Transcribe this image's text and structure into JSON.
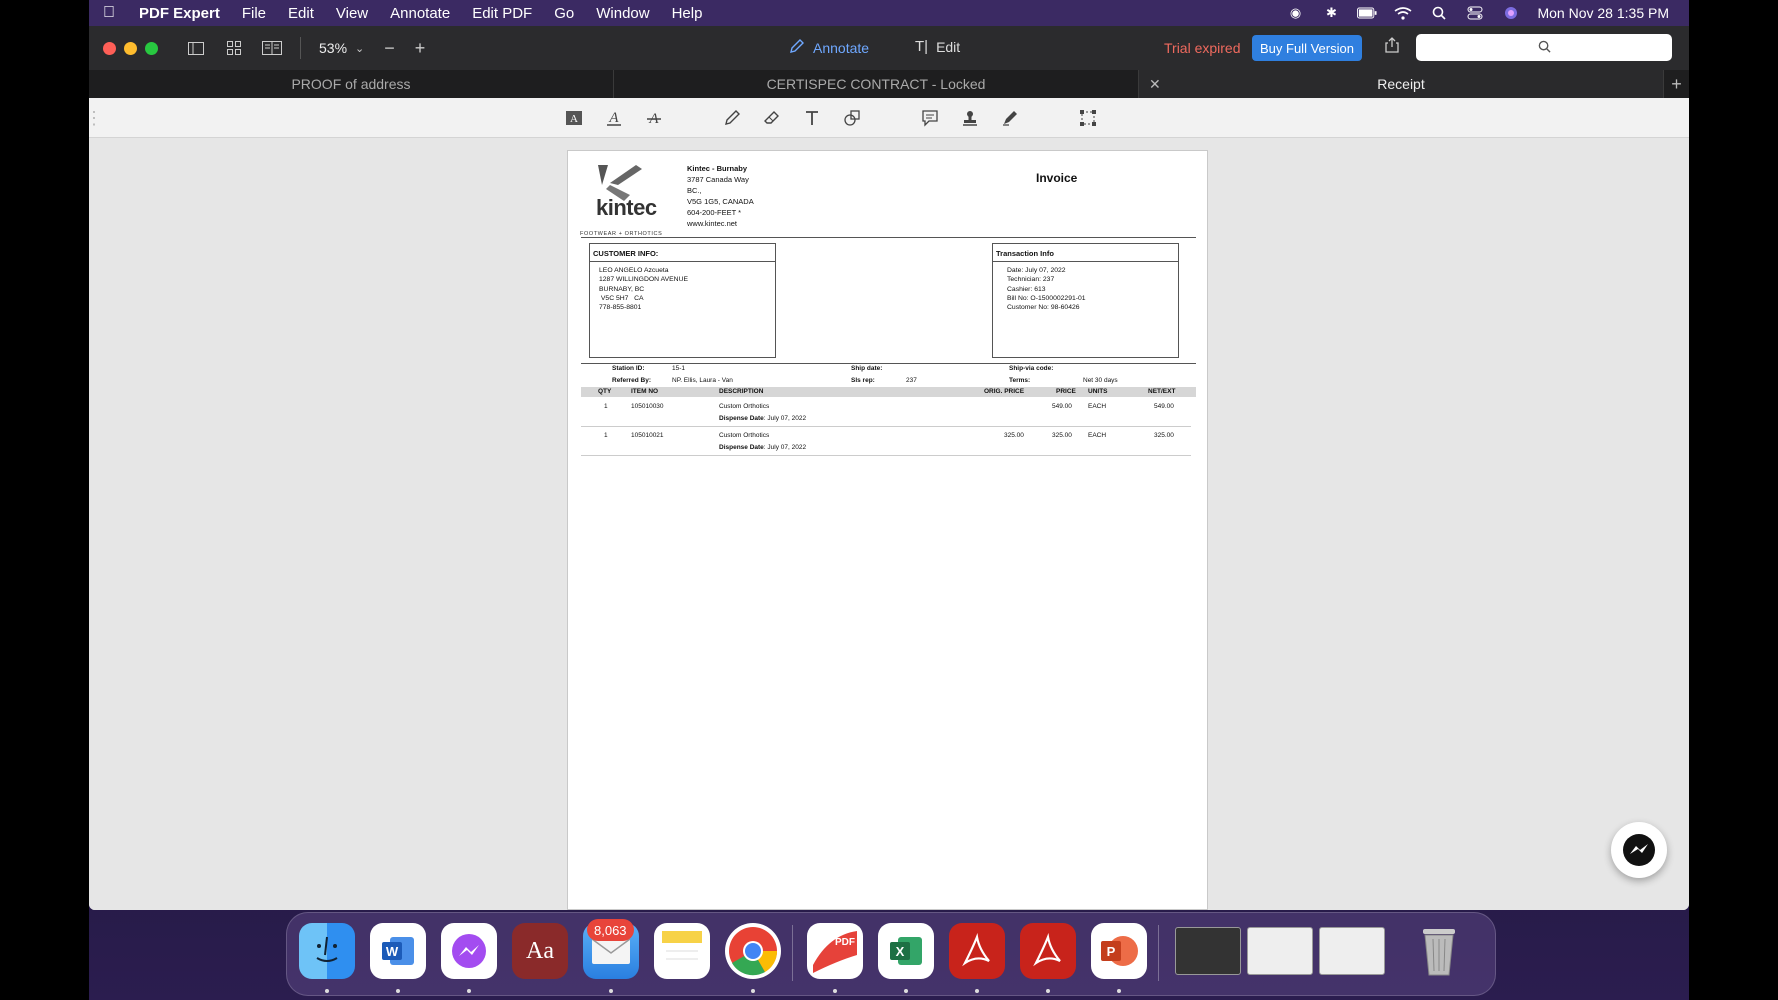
{
  "menubar": {
    "app": "PDF Expert",
    "items": [
      "File",
      "Edit",
      "View",
      "Annotate",
      "Edit PDF",
      "Go",
      "Window",
      "Help"
    ],
    "clock": "Mon Nov 28  1:35 PM"
  },
  "toolbar": {
    "zoom": "53%",
    "annotate_label": "Annotate",
    "edit_label": "Edit",
    "trial_text": "Trial expired",
    "buy_label": "Buy Full Version"
  },
  "tabs": [
    {
      "label": "PROOF of address"
    },
    {
      "label": "CERTISPEC CONTRACT - Locked"
    },
    {
      "label": "Receipt"
    }
  ],
  "invoice": {
    "title": "Invoice",
    "logo_text": "kintec",
    "logo_sub": "FOOTWEAR + ORTHOTICS",
    "company": [
      "Kintec - Burnaby",
      "3787 Canada Way",
      "BC.,",
      "V5G 1G5, CANADA",
      "604-200-FEET *",
      "www.kintec.net"
    ],
    "customer_header": "CUSTOMER INFO:",
    "customer": [
      "LEO ANGELO Azcueta",
      "1287 WILLINGDON AVENUE",
      "BURNABY, BC",
      " V5C 5H7   CA",
      "778-855-8801"
    ],
    "transaction_header": "Transaction Info",
    "transaction": [
      "Date: July 07, 2022",
      "Technician: 237",
      "Cashier: 613",
      "Bill No: O-1500002291-01",
      "Customer No: 98-60426"
    ],
    "meta": {
      "station_label": "Station ID:",
      "station": "15-1",
      "referred_label": "Referred By:",
      "referred": "NP. Ellis, Laura - Van",
      "ship_date_label": "Ship date:",
      "sls_label": "Sls rep:",
      "sls": "237",
      "shipvia_label": "Ship-via code:",
      "terms_label": "Terms:",
      "terms": "Net 30 days"
    },
    "columns": [
      "QTY",
      "ITEM NO",
      "DESCRIPTION",
      "ORIG. PRICE",
      "PRICE",
      "UNITS",
      "NET/EXT"
    ],
    "dispense_label": "Dispense Date",
    "rows": [
      {
        "qty": "1",
        "item": "105010030",
        "desc": "Custom Orthotics",
        "dispense": ": July 07, 2022",
        "orig": "",
        "price": "549.00",
        "units": "EACH",
        "net": "549.00"
      },
      {
        "qty": "1",
        "item": "105010021",
        "desc": "Custom Orthotics",
        "dispense": ": July 07, 2022",
        "orig": "325.00",
        "price": "325.00",
        "units": "EACH",
        "net": "325.00"
      }
    ]
  },
  "dock": {
    "mail_badge": "8,063",
    "pdf_label": "PDF",
    "dictionary_label": "Aa"
  }
}
